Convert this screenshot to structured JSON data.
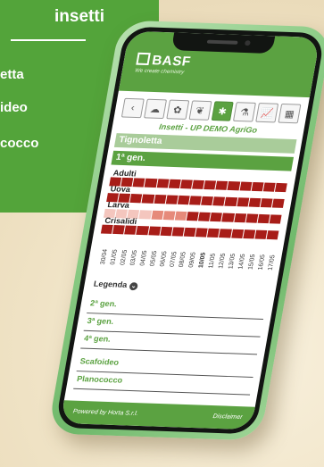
{
  "promo": {
    "title": "insetti",
    "items": [
      "etta",
      "ideo",
      "cocco"
    ]
  },
  "app": {
    "brand": "BASF",
    "tagline": "We create chemistry",
    "toolbar": [
      {
        "icon": "back-arrow-icon",
        "glyph": "‹",
        "active": false
      },
      {
        "icon": "weather-icon",
        "glyph": "☁",
        "active": false
      },
      {
        "icon": "vine-icon",
        "glyph": "✿",
        "active": false
      },
      {
        "icon": "leaf-icon",
        "glyph": "❦",
        "active": false
      },
      {
        "icon": "insect-icon",
        "glyph": "✱",
        "active": true
      },
      {
        "icon": "lab-flask-icon",
        "glyph": "⚗",
        "active": false
      },
      {
        "icon": "chart-icon",
        "glyph": "📈",
        "active": false
      },
      {
        "icon": "grid-icon",
        "glyph": "▦",
        "active": false
      }
    ],
    "subtitle": "Insetti - UP DEMO AgriGo",
    "panel_title": "Tignoletta",
    "gen1": "1ª gen.",
    "stages": [
      {
        "label": "Adulti",
        "levels": [
          3,
          3,
          3,
          3,
          3,
          3,
          3,
          3,
          3,
          3,
          3,
          3,
          3,
          3,
          3
        ]
      },
      {
        "label": "Uova",
        "levels": [
          3,
          3,
          3,
          3,
          3,
          3,
          3,
          3,
          3,
          3,
          3,
          3,
          3,
          3,
          3
        ]
      },
      {
        "label": "Larva",
        "levels": [
          1,
          1,
          1,
          1,
          2,
          2,
          2,
          3,
          3,
          3,
          3,
          3,
          3,
          3,
          3
        ]
      },
      {
        "label": "Crisalidi",
        "levels": [
          3,
          3,
          3,
          3,
          3,
          3,
          3,
          3,
          3,
          3,
          3,
          3,
          3,
          3,
          3
        ]
      }
    ],
    "heat_colors": {
      "1": "#f4c6be",
      "2": "#e68a7a",
      "3": "#a81d18"
    },
    "dates": [
      "30/04",
      "01/05",
      "02/05",
      "03/05",
      "04/05",
      "05/05",
      "06/05",
      "07/05",
      "08/05",
      "09/05",
      "10/05",
      "11/05",
      "12/05",
      "13/05",
      "14/05",
      "15/05",
      "16/05",
      "17/05"
    ],
    "today": "10/05",
    "legend": "Legenda",
    "generations": [
      "2ª gen.",
      "3ª gen.",
      "4ª gen."
    ],
    "other_insects": [
      "Scafoideo",
      "Planococco"
    ],
    "footer_left": "Powered by Horta S.r.l.",
    "footer_right": "Disclaimer"
  }
}
